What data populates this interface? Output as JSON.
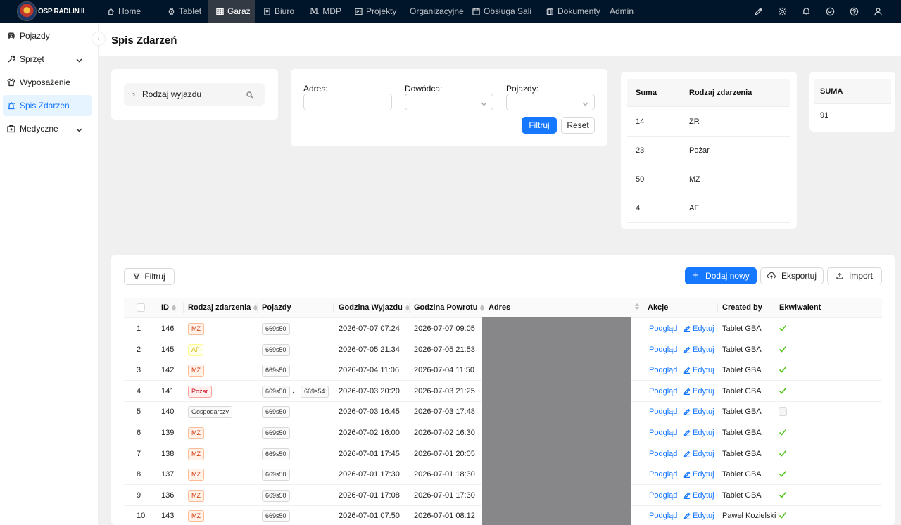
{
  "brand": {
    "name": "OSP RADLIN II"
  },
  "nav": [
    {
      "label": "Home",
      "icon": "home-icon"
    },
    {
      "label": "Tablet",
      "icon": "watch-icon"
    },
    {
      "label": "Garaż",
      "icon": "table-icon",
      "active": true
    },
    {
      "label": "Biuro",
      "icon": "document-icon"
    },
    {
      "label": "MDP",
      "icon": "m-letter-icon"
    },
    {
      "label": "Projekty",
      "icon": "project-icon"
    },
    {
      "label": "Organizacyjne",
      "icon": ""
    },
    {
      "label": "Obsługa Sali",
      "icon": "calendar-icon"
    },
    {
      "label": "Dokumenty",
      "icon": "file-icon"
    },
    {
      "label": "Admin",
      "icon": ""
    }
  ],
  "top_actions": [
    "pen-icon",
    "settings-icon",
    "bell-icon",
    "check-circle-icon",
    "help-icon",
    "user-icon"
  ],
  "sidebar": [
    {
      "label": "Pojazdy",
      "icon": "car-icon"
    },
    {
      "label": "Sprzęt",
      "icon": "tool-icon",
      "expandable": true
    },
    {
      "label": "Wyposażenie",
      "icon": "shirt-icon"
    },
    {
      "label": "Spis Zdarzeń",
      "icon": "alert-icon",
      "active": true
    },
    {
      "label": "Medyczne",
      "icon": "medical-box-icon",
      "expandable": true
    }
  ],
  "page": {
    "title": "Spis Zdarzeń"
  },
  "tree_search": {
    "label": "Rodzaj wyjazdu"
  },
  "filters": {
    "adres_label": "Adres",
    "dowodca_label": "Dowódca",
    "pojazdy_label": "Pojazdy",
    "colon": ":",
    "filter_btn": "Filtruj",
    "reset_btn": "Reset"
  },
  "summary": {
    "headers": [
      "Suma",
      "Rodzaj zdarzenia"
    ],
    "rows": [
      {
        "count": "14",
        "type": "ZR"
      },
      {
        "count": "23",
        "type": "Pożar"
      },
      {
        "count": "50",
        "type": "MZ"
      },
      {
        "count": "4",
        "type": "AF"
      }
    ]
  },
  "total": {
    "header": "SUMA",
    "value": "91"
  },
  "toolbar": {
    "filter": "Filtruj",
    "add_new": "Dodaj nowy",
    "export": "Eksportuj",
    "import": "Import"
  },
  "table": {
    "columns": [
      "ID",
      "Rodzaj zdarzenia",
      "Pojazdy",
      "Godzina Wyjazdu",
      "Godzina Powrotu",
      "Adres",
      "Akcje",
      "Created by",
      "Ekwiwalent"
    ],
    "view_label": "Podgląd",
    "edit_label": "Edytuj",
    "rows": [
      {
        "n": "1",
        "id": "146",
        "type": "MZ",
        "vehicles": [
          "669s50"
        ],
        "dep": "2026-07-07 07:24",
        "ret": "2026-07-07 09:05",
        "by": "Tablet GBA",
        "eq": true
      },
      {
        "n": "2",
        "id": "145",
        "type": "AF",
        "vehicles": [
          "669s50"
        ],
        "dep": "2026-07-05 21:34",
        "ret": "2026-07-05 21:53",
        "by": "Tablet GBA",
        "eq": true
      },
      {
        "n": "3",
        "id": "142",
        "type": "MZ",
        "vehicles": [
          "669s50"
        ],
        "dep": "2026-07-04 11:06",
        "ret": "2026-07-04 11:50",
        "by": "Tablet GBA",
        "eq": true
      },
      {
        "n": "4",
        "id": "141",
        "type": "Pożar",
        "vehicles": [
          "669s50",
          "669s54"
        ],
        "dep": "2026-07-03 20:20",
        "ret": "2026-07-03 21:25",
        "by": "Tablet GBA",
        "eq": true
      },
      {
        "n": "5",
        "id": "140",
        "type": "Gospodarczy",
        "vehicles": [
          "669s50"
        ],
        "dep": "2026-07-03 16:45",
        "ret": "2026-07-03 17:48",
        "by": "Tablet GBA",
        "eq": false
      },
      {
        "n": "6",
        "id": "139",
        "type": "MZ",
        "vehicles": [
          "669s50"
        ],
        "dep": "2026-07-02 16:00",
        "ret": "2026-07-02 16:30",
        "by": "Tablet GBA",
        "eq": true
      },
      {
        "n": "7",
        "id": "138",
        "type": "MZ",
        "vehicles": [
          "669s50"
        ],
        "dep": "2026-07-01 17:45",
        "ret": "2026-07-01 20:05",
        "by": "Tablet GBA",
        "eq": true
      },
      {
        "n": "8",
        "id": "137",
        "type": "MZ",
        "vehicles": [
          "669s50"
        ],
        "dep": "2026-07-01 17:30",
        "ret": "2026-07-01 18:30",
        "by": "Tablet GBA",
        "eq": true
      },
      {
        "n": "9",
        "id": "136",
        "type": "MZ",
        "vehicles": [
          "669s50"
        ],
        "dep": "2026-07-01 17:08",
        "ret": "2026-07-01 17:30",
        "by": "Tablet GBA",
        "eq": true
      },
      {
        "n": "10",
        "id": "143",
        "type": "MZ",
        "vehicles": [
          "669s50"
        ],
        "dep": "2026-07-01 07:50",
        "ret": "2026-07-01 08:12",
        "by": "Paweł Kozielski",
        "eq": true
      }
    ]
  }
}
